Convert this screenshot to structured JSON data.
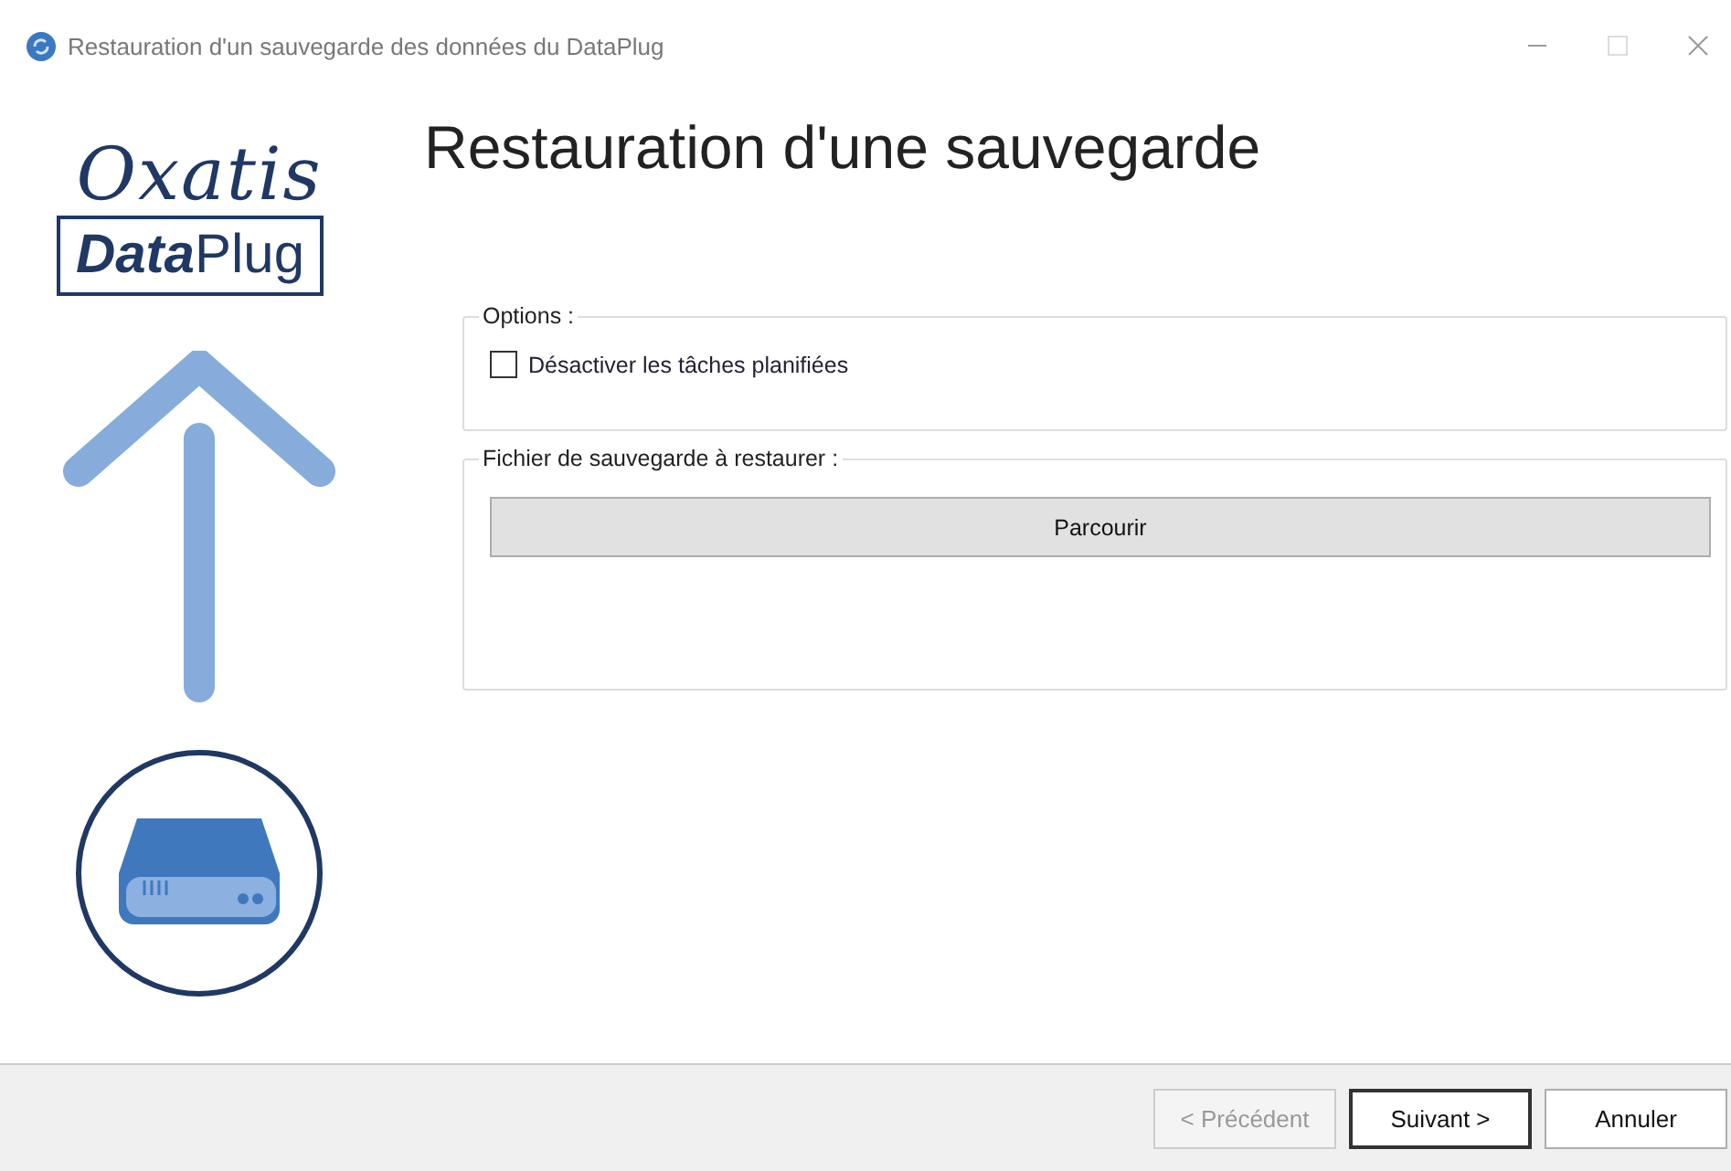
{
  "window": {
    "title": "Restauration d'un sauvegarde des données du DataPlug"
  },
  "logo": {
    "wordmark": "Oxatis",
    "product": "**Data**Plug"
  },
  "heading": "Restauration d'une sauvegarde",
  "options": {
    "legend": "Options :",
    "checkboxes": [
      {
        "label": "Désactiver les tâches planifiées",
        "checked": false
      }
    ]
  },
  "file_group": {
    "legend": "Fichier de sauvegarde à restaurer :",
    "browse_button": "Parcourir"
  },
  "buttons": [
    {
      "label": "< Précédent",
      "disabled": true,
      "default": false
    },
    {
      "label": "Suivant >",
      "disabled": false,
      "default": true
    },
    {
      "label": "Annuler",
      "disabled": false,
      "default": false
    }
  ]
}
